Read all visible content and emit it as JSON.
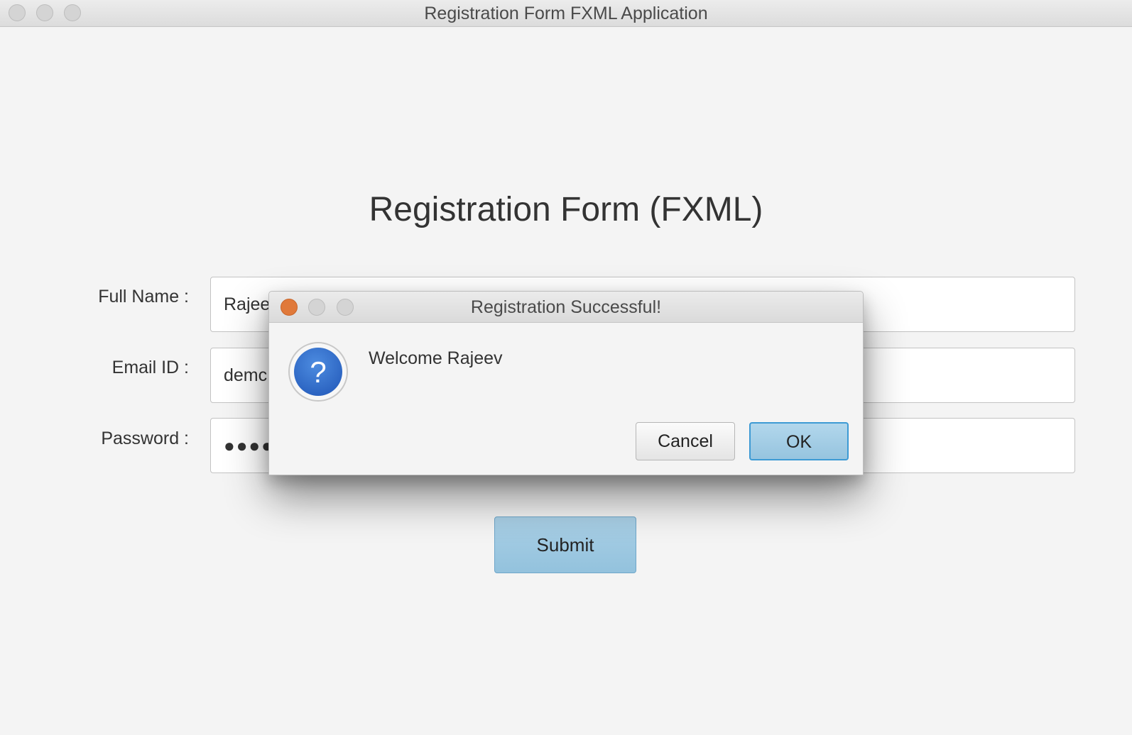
{
  "window": {
    "title": "Registration Form FXML Application"
  },
  "form": {
    "heading": "Registration Form (FXML)",
    "fields": [
      {
        "label": "Full Name :",
        "value": "Rajee"
      },
      {
        "label": "Email ID :",
        "value": "demc"
      },
      {
        "label": "Password :",
        "value": "●●●●"
      }
    ],
    "submit_label": "Submit"
  },
  "dialog": {
    "title": "Registration Successful!",
    "icon": "question-icon",
    "icon_glyph": "?",
    "message": "Welcome Rajeev",
    "cancel_label": "Cancel",
    "ok_label": "OK"
  },
  "colors": {
    "accent": "#3d9ad4",
    "close_button": "#e0793a",
    "icon_blue": "#2f6fce"
  }
}
